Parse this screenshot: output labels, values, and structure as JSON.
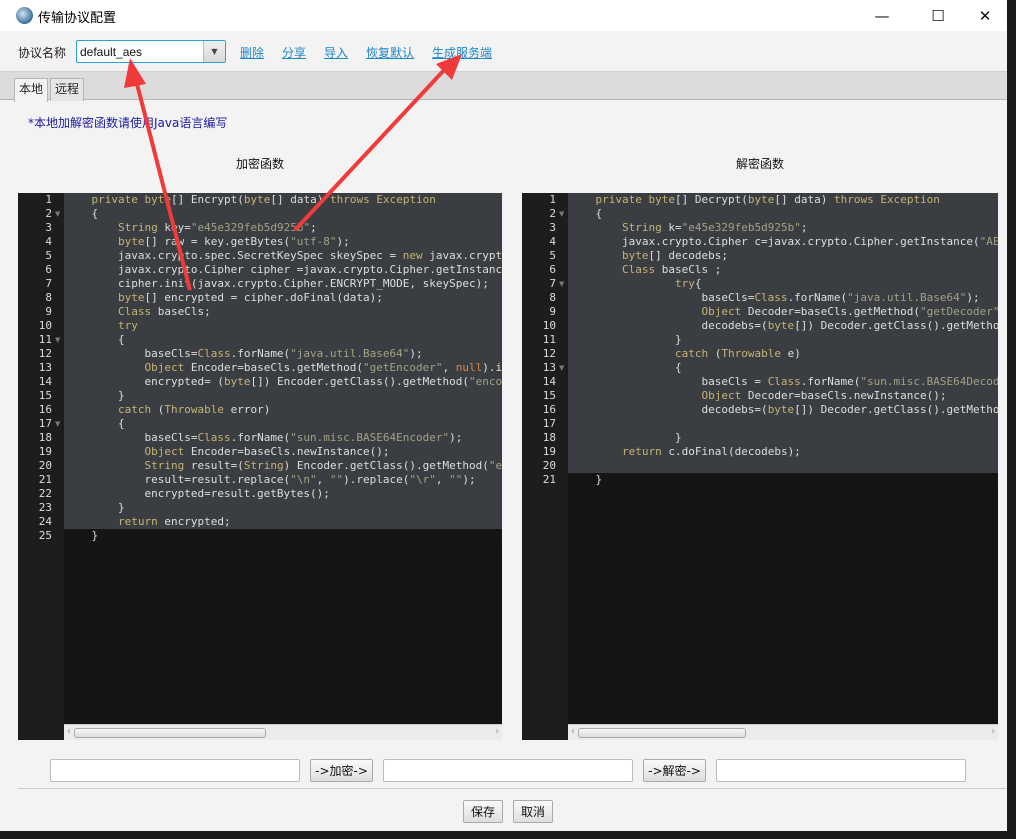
{
  "window": {
    "title": "传输协议配置",
    "minimize": "—",
    "maximize": "☐",
    "close": "✕"
  },
  "toolbar": {
    "label": "协议名称",
    "protocol_value": "default_aes",
    "links": [
      "删除",
      "分享",
      "导入",
      "恢复默认",
      "生成服务端"
    ]
  },
  "tabs": [
    {
      "label": "本地",
      "active": true
    },
    {
      "label": "远程",
      "active": false
    }
  ],
  "note": "*本地加解密函数请使用Java语言编写",
  "encrypt": {
    "heading": "加密函数",
    "lines": [
      "    private byte[] Encrypt(byte[] data) throws Exception",
      "    {",
      "        String key=\"e45e329feb5d925b\";",
      "        byte[] raw = key.getBytes(\"utf-8\");",
      "        javax.crypto.spec.SecretKeySpec skeySpec = new javax.crypt",
      "        javax.crypto.Cipher cipher =javax.crypto.Cipher.getInstanc",
      "        cipher.init(javax.crypto.Cipher.ENCRYPT_MODE, skeySpec);",
      "        byte[] encrypted = cipher.doFinal(data);",
      "        Class baseCls;",
      "        try",
      "        {",
      "            baseCls=Class.forName(\"java.util.Base64\");",
      "            Object Encoder=baseCls.getMethod(\"getEncoder\", null).i",
      "            encrypted= (byte[]) Encoder.getClass().getMethod(\"enco",
      "        }",
      "        catch (Throwable error)",
      "        {",
      "            baseCls=Class.forName(\"sun.misc.BASE64Encoder\");",
      "            Object Encoder=baseCls.newInstance();",
      "            String result=(String) Encoder.getClass().getMethod(\"e",
      "            result=result.replace(\"\\n\", \"\").replace(\"\\r\", \"\");",
      "            encrypted=result.getBytes();",
      "        }",
      "        return encrypted;",
      "    }"
    ],
    "fold_lines": [
      2,
      11,
      17
    ]
  },
  "decrypt": {
    "heading": "解密函数",
    "lines": [
      "    private byte[] Decrypt(byte[] data) throws Exception",
      "    {",
      "        String k=\"e45e329feb5d925b\";",
      "        javax.crypto.Cipher c=javax.crypto.Cipher.getInstance(\"AE",
      "        byte[] decodebs;",
      "        Class baseCls ;",
      "                try{",
      "                    baseCls=Class.forName(\"java.util.Base64\");",
      "                    Object Decoder=baseCls.getMethod(\"getDecoder\"",
      "                    decodebs=(byte[]) Decoder.getClass().getMetho",
      "                }",
      "                catch (Throwable e)",
      "                {",
      "                    baseCls = Class.forName(\"sun.misc.BASE64Decod",
      "                    Object Decoder=baseCls.newInstance();",
      "                    decodebs=(byte[]) Decoder.getClass().getMetho",
      "",
      "                }",
      "        return c.doFinal(decodebs);",
      "",
      "    }"
    ],
    "fold_lines": [
      2,
      7,
      13
    ]
  },
  "bottom": {
    "plain_input": "",
    "encrypt_button": "->加密->",
    "cipher_input": "",
    "decrypt_button": "->解密->",
    "result_input": "",
    "save": "保存",
    "cancel": "取消"
  },
  "colors": {
    "link": "#1f86c7",
    "annotation_arrow": "#ef3b3b",
    "editor_bg": "#3a3d41"
  }
}
